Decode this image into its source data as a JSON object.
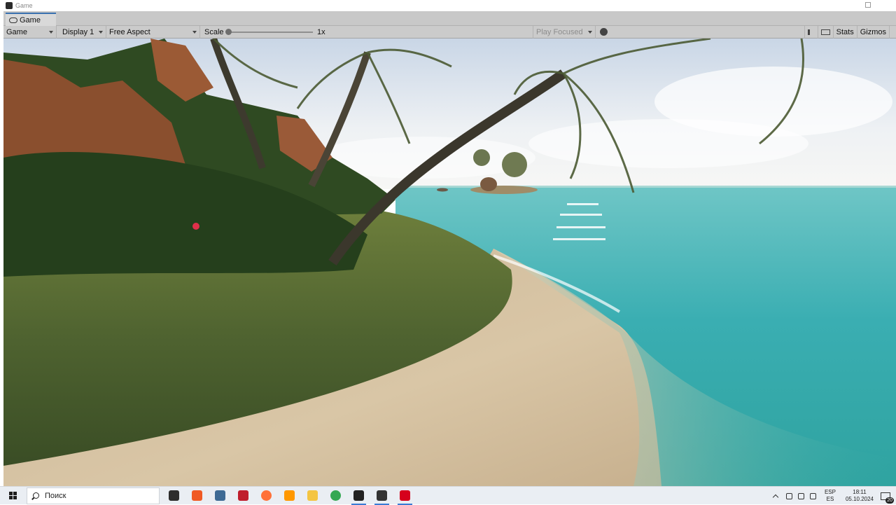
{
  "window": {
    "title": "Game"
  },
  "tab": {
    "label": "Game",
    "icon": "game-controller-icon"
  },
  "toolbar": {
    "view_dropdown": "Game",
    "display_dropdown": "Display 1",
    "aspect_dropdown": "Free Aspect",
    "scale_label": "Scale",
    "scale_value": "1x",
    "play_mode_dropdown": "Play Focused",
    "stats_label": "Stats",
    "gizmos_label": "Gizmos"
  },
  "scene": {
    "description_icon": "game-view-render"
  },
  "taskbar": {
    "search_placeholder": "Поиск",
    "apps": [
      {
        "name": "task-view-icon",
        "color": "#2d2d2d"
      },
      {
        "name": "brave-icon",
        "color": "#f05a24"
      },
      {
        "name": "pgadmin-icon",
        "color": "#3e6a94"
      },
      {
        "name": "filezilla-icon",
        "color": "#bf1e2d"
      },
      {
        "name": "firefox-icon",
        "color": "#ff7139"
      },
      {
        "name": "sublime-icon",
        "color": "#ff9800"
      },
      {
        "name": "file-explorer-icon",
        "color": "#f4c542"
      },
      {
        "name": "chrome-icon",
        "color": "#34a853"
      },
      {
        "name": "unity-hub-icon",
        "color": "#222222"
      },
      {
        "name": "unity-icon",
        "color": "#333333"
      },
      {
        "name": "unity-editor-icon",
        "color": "#d6001c"
      }
    ],
    "language_top": "ESP",
    "language_bottom": "ES",
    "time": "18:11",
    "date": "05.10.2024",
    "notification_count": "20"
  }
}
